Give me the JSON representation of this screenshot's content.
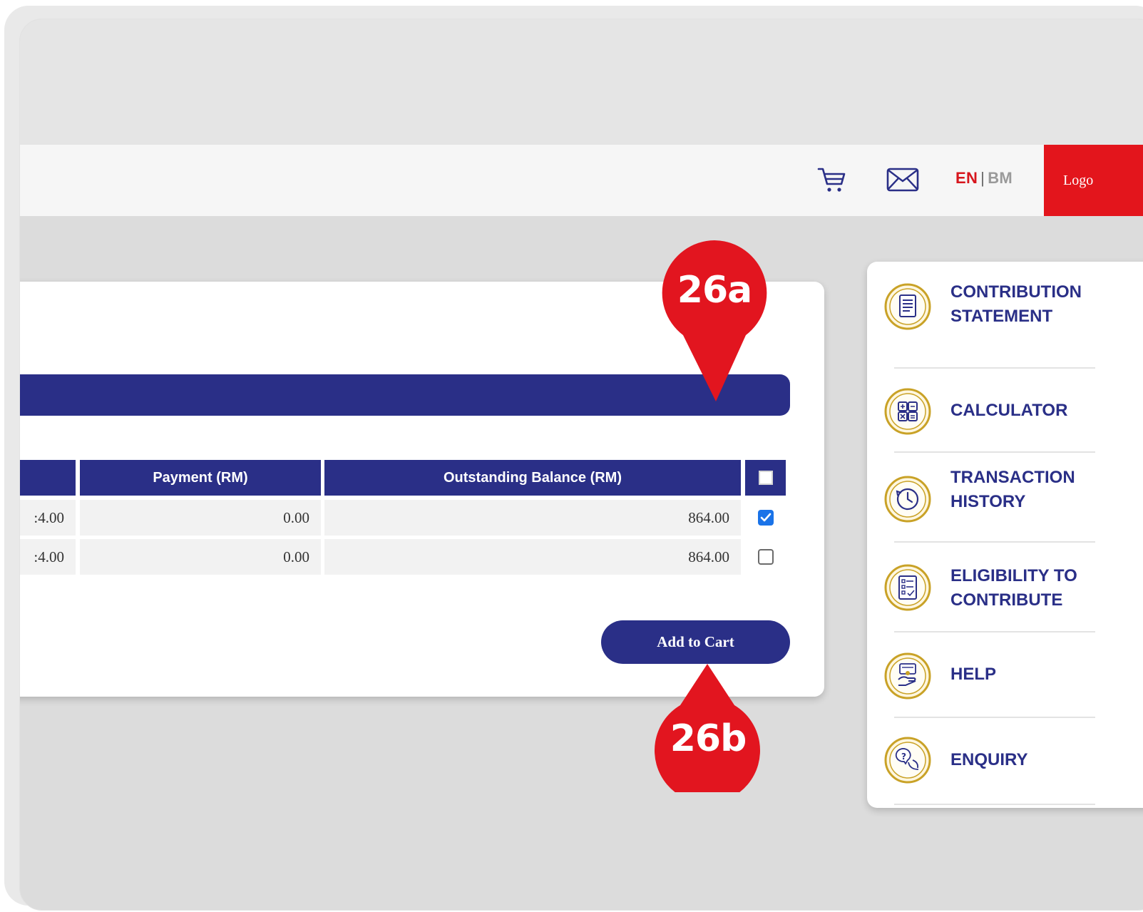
{
  "header": {
    "lang_en": "EN",
    "lang_sep": "|",
    "lang_bm": "BM",
    "logout_label": "Logo",
    "icons": [
      "cart-icon",
      "mail-icon"
    ]
  },
  "table": {
    "columns": [
      "",
      "Payment (RM)",
      "Outstanding Balance (RM)"
    ],
    "rows": [
      {
        "prev": ":4.00",
        "payment": "0.00",
        "outstanding": "864.00",
        "checked": true
      },
      {
        "prev": ":4.00",
        "payment": "0.00",
        "outstanding": "864.00",
        "checked": false
      }
    ]
  },
  "add_to_cart_label": "Add to Cart",
  "annotations": {
    "a": "26a",
    "b": "26b"
  },
  "sidebar": {
    "items": [
      {
        "label": "CONTRIBUTION STATEMENT",
        "icon": "statement-icon"
      },
      {
        "label": "CALCULATOR",
        "icon": "calculator-icon"
      },
      {
        "label": "TRANSACTION HISTORY",
        "icon": "history-clock-icon"
      },
      {
        "label": "ELIGIBILITY TO CONTRIBUTE",
        "icon": "eligibility-form-icon"
      },
      {
        "label": "HELP",
        "icon": "help-icon"
      },
      {
        "label": "ENQUIRY",
        "icon": "enquiry-icon"
      }
    ]
  },
  "colors": {
    "navy": "#2a2f87",
    "red": "#e3151c",
    "gold": "#c9a227",
    "checkbox_blue": "#1a73e8"
  }
}
